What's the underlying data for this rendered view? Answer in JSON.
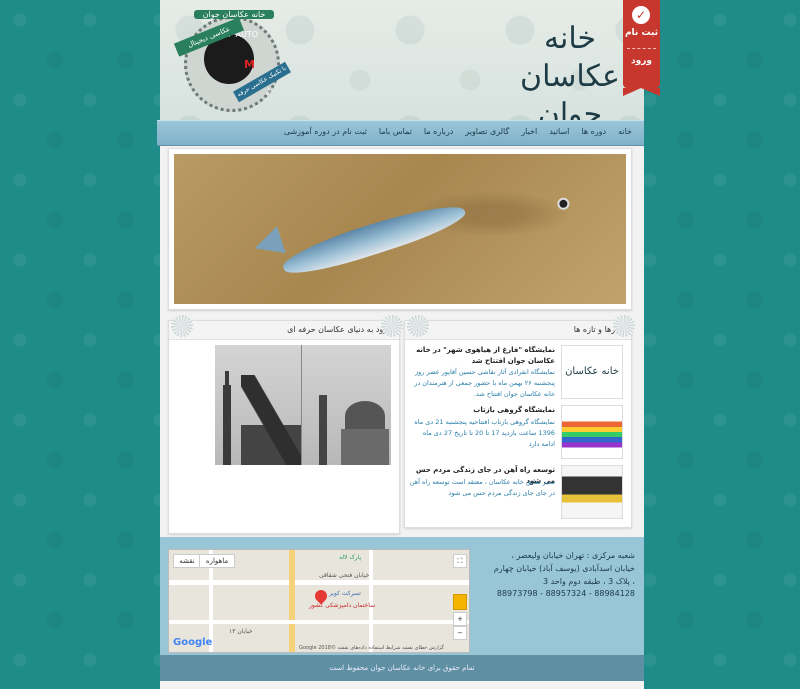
{
  "header": {
    "logo_text": "خانه عکاسان جوان",
    "dial_label": "خانه عکاسان جوان",
    "dial_mode": "M",
    "dial_letters": "S  A  P  AUTO",
    "ribbon_top": "عکاسی دیجیتال",
    "ribbon_bottom": "با تکنیک عکاسی حرفه ای",
    "register_label": "ثبت نام",
    "login_label": "ورود"
  },
  "nav": {
    "items": [
      "خانه",
      "دوره ها",
      "اساتید",
      "اخبار",
      "گالری تصاویر",
      "درباره ما",
      "تماس باما",
      "ثبت نام در دوره آموزشی"
    ]
  },
  "panels": {
    "left_title": "ورود به دنیای عکاسان حرفه ای",
    "right_title": "خبرها و تازه ها"
  },
  "news": [
    {
      "title": "نمایشگاه \"فارغ از هیاهوی شهر\" در خانه عکاسان جوان افتتاح شد",
      "body": "نمایشگاه انفرادی آثار نقاشی حسین آقاپور عصر روز پنجشنبه ۲۶ بهمن ماه با حضور جمعی از هنرمندان در خانه عکاسان جوان افتتاح شد."
    },
    {
      "title": "نمایشگاه گروهی بازتاب",
      "body": "نمایشگاه گروهی بازتاب افتتاحیه پنجشنبه 21 دی ماه 1396 ساعت بازدید 17 تا 20 تا تاریخ 27 دی ماه ادامه دارد"
    },
    {
      "title": "توسعه راه آهن در جای زندگی مردم حس می شود",
      "body": "مدیر سابق خانه عکاسان ، معتقد است توسعه راه آهن در جای جای زندگی مردم حس می شود"
    }
  ],
  "footer": {
    "address": "شعبه مرکزی : تهران خیابان ولیعصر ، خیابان اسدآبادی (یوسف آباد) خیابان چهارم ، پلاک 3 ، طبقه دوم واحد 3",
    "phones": "88984128 - 88957324 - 88973798",
    "copyright": "تمام حقوق برای خانه عکاسان جوان محفوظ است"
  },
  "map": {
    "place_label": "ساختمان دامپزشکی کشور",
    "place_label2": "تسرکت کویر",
    "street1": "خیابان فتحی شقاقی",
    "street2": "پارک لاله",
    "street3": "خیابان ۱۳",
    "btn_map": "نقشه",
    "btn_sat": "ماهواره",
    "google_label": "Google",
    "copyright": "گزارش خطای نقشه  شرایط استفاده  داده‌های نقشه ©2018 Google"
  }
}
